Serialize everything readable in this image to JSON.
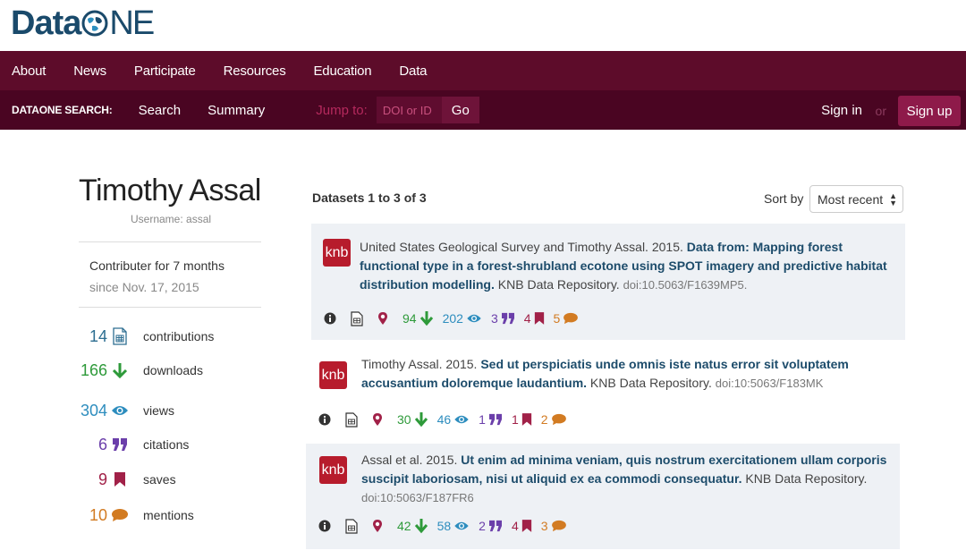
{
  "logo": {
    "part1": "Data",
    "part2": "NE"
  },
  "nav": {
    "main": [
      "About",
      "News",
      "Participate",
      "Resources",
      "Education",
      "Data"
    ],
    "sub_label": "DATAONE SEARCH:",
    "sub_links": [
      "Search",
      "Summary"
    ],
    "jump_label": "Jump to:",
    "jump_placeholder": "DOI or ID",
    "go": "Go",
    "signin": "Sign in",
    "or": "or",
    "signup": "Sign up"
  },
  "profile": {
    "name": "Timothy Assal",
    "username": "Username: assal",
    "contributor": "Contributer for 7 months",
    "since": "since Nov. 17, 2015",
    "stats": [
      {
        "value": "14",
        "label": "contributions",
        "icon": "spreadsheet-icon"
      },
      {
        "value": "166",
        "label": "downloads",
        "icon": "download-icon"
      },
      {
        "value": "304",
        "label": "views",
        "icon": "eye-icon"
      },
      {
        "value": "6",
        "label": "citations",
        "icon": "quote-icon"
      },
      {
        "value": "9",
        "label": "saves",
        "icon": "bookmark-icon"
      },
      {
        "value": "10",
        "label": "mentions",
        "icon": "comment-icon"
      }
    ]
  },
  "datasets": {
    "header": "Datasets 1 to 3 of 3",
    "sort_label": "Sort by",
    "sort_value": "Most recent",
    "items": [
      {
        "badge": "knb",
        "authors": "United States Geological Survey and Timothy Assal. 2015. ",
        "title": "Data from: Mapping forest functional type in a forest-shrubland ecotone using SPOT imagery and predictive habitat distribution modelling.",
        "repo": " KNB Data Repository. ",
        "doi": "doi:10.5063/F1639MP5.",
        "downloads": "94",
        "views": "202",
        "citations": "3",
        "saves": "4",
        "mentions": "5"
      },
      {
        "badge": "knb",
        "authors": "Timothy Assal. 2015. ",
        "title": "Sed ut perspiciatis unde omnis iste natus error sit voluptatem accusantium doloremque laudantium.",
        "repo": " KNB Data Repository. ",
        "doi": "doi:10:5063/F183MK",
        "downloads": "30",
        "views": "46",
        "citations": "1",
        "saves": "1",
        "mentions": "2"
      },
      {
        "badge": "knb",
        "authors": "Assal et al. 2015. ",
        "title": "Ut enim ad minima veniam, quis nostrum exercitationem ullam corporis suscipit laboriosam, nisi ut aliquid ex ea commodi consequatur.",
        "repo": " KNB Data Repository. ",
        "doi": "doi:10:5063/F187FR6",
        "downloads": "42",
        "views": "58",
        "citations": "2",
        "saves": "4",
        "mentions": "3"
      }
    ]
  },
  "colors": {
    "nav_main": "#5d0c2a",
    "nav_sub": "#4a0522",
    "title_link": "#1d4c6b",
    "downloads": "#2e9a3a",
    "views": "#2d8dbe",
    "citations": "#6b3faa",
    "saves": "#a12148",
    "mentions": "#d27b22"
  }
}
